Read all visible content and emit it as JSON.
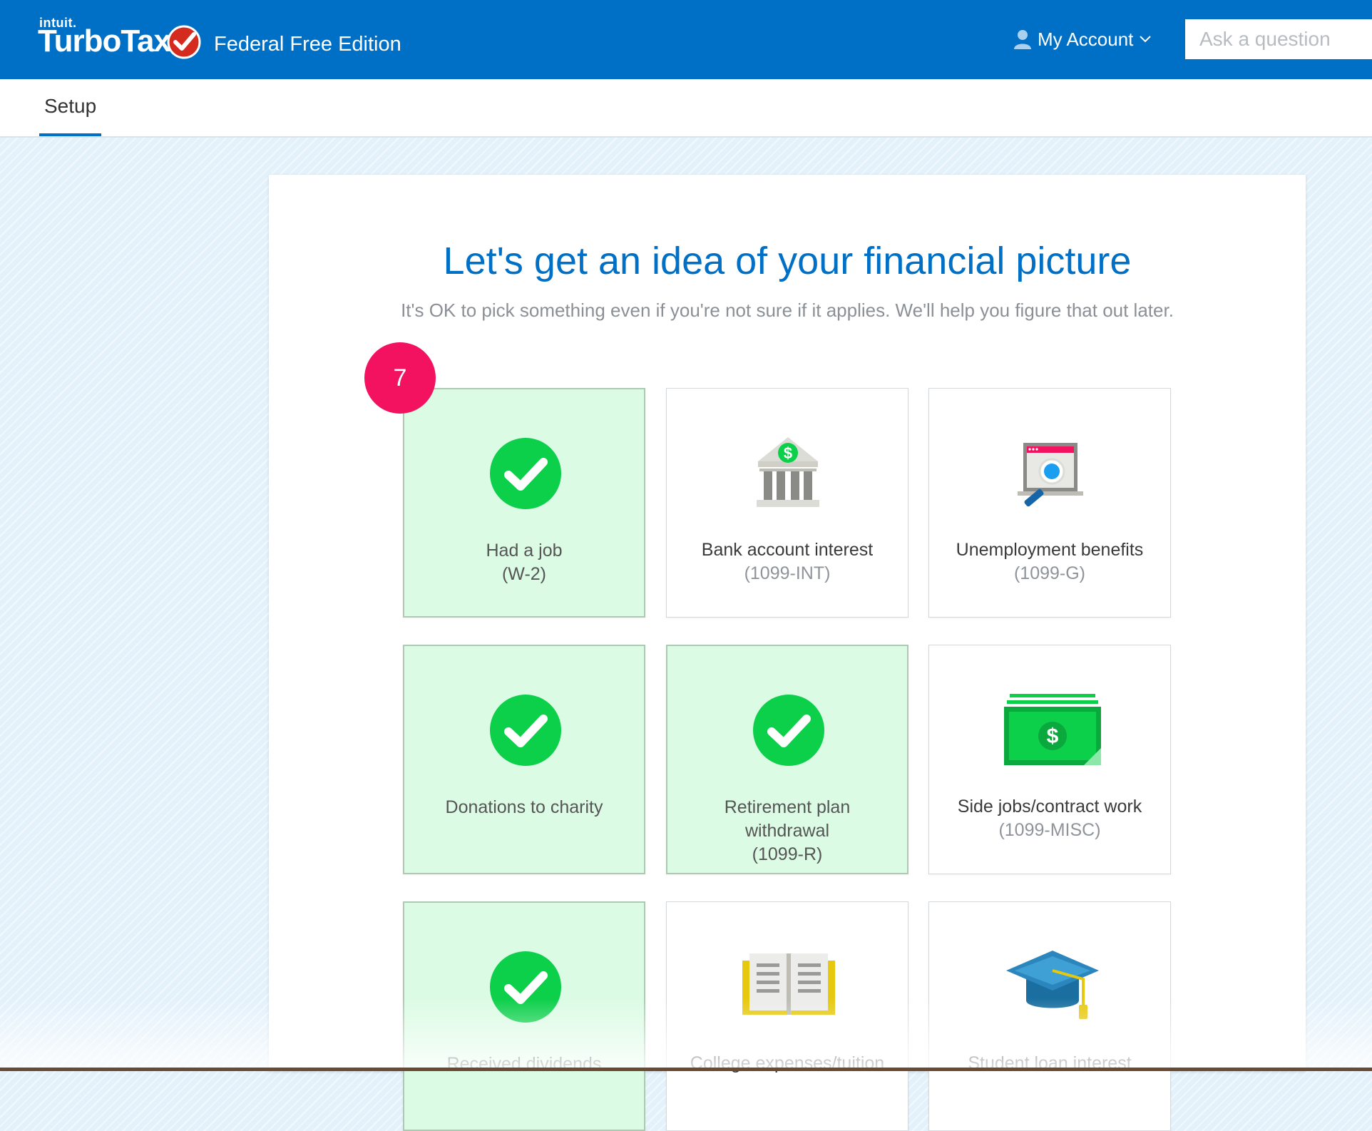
{
  "header": {
    "brand_small": "intuit.",
    "brand": "TurboTax",
    "edition": "Federal Free Edition",
    "account_label": "My Account",
    "search_placeholder": "Ask a question"
  },
  "subnav": {
    "tab": "Setup"
  },
  "main": {
    "title": "Let's get an idea of your financial picture",
    "subtitle": "It's OK to pick something even if you're not sure if it applies. We'll help you figure that out later.",
    "badge": "7",
    "tiles": [
      {
        "label": "Had a job",
        "sub": "(W-2)",
        "selected": true,
        "icon": "check-icon"
      },
      {
        "label": "Bank account interest",
        "sub": "(1099-INT)",
        "selected": false,
        "icon": "bank-icon"
      },
      {
        "label": "Unemployment benefits",
        "sub": "(1099-G)",
        "selected": false,
        "icon": "laptop-search-icon"
      },
      {
        "label": "Donations to charity",
        "sub": "",
        "selected": true,
        "icon": "check-icon"
      },
      {
        "label": "Retirement plan withdrawal",
        "sub": "(1099-R)",
        "selected": true,
        "icon": "check-icon"
      },
      {
        "label": "Side jobs/contract work",
        "sub": "(1099-MISC)",
        "selected": false,
        "icon": "money-icon"
      },
      {
        "label": "Received dividends",
        "sub": "",
        "selected": true,
        "icon": "check-icon"
      },
      {
        "label": "College expenses/tuition",
        "sub": "",
        "selected": false,
        "icon": "book-icon"
      },
      {
        "label": "Student loan interest",
        "sub": "",
        "selected": false,
        "icon": "graduation-cap-icon"
      }
    ]
  },
  "colors": {
    "header_blue": "#0070c6",
    "selected_tile": "#dcfbe4",
    "check_green": "#0ccf4a",
    "badge_pink": "#f2125f"
  }
}
